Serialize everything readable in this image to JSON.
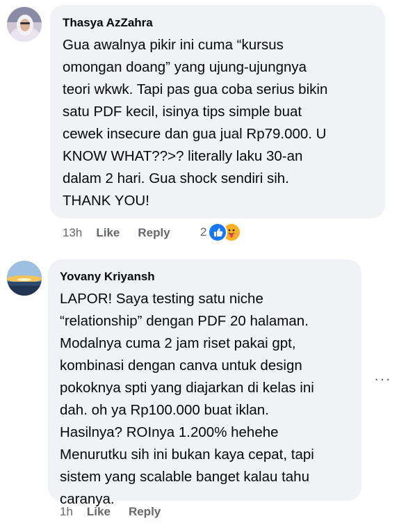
{
  "comments": [
    {
      "author": "Thasya AzZahra",
      "text": "Gua awalnya pikir ini cuma “kursus\nomongan doang” yang ujung-ujungnya\nteori wkwk. Tapi pas gua coba serius bikin\nsatu PDF kecil, isinya tips simple buat\ncewek insecure dan gua jual Rp79.000. U\nKNOW WHAT??>? literally laku 30-an\ndalam 2 hari. Gua shock sendiri sih.\nTHANK YOU!",
      "time": "13h",
      "like_label": "Like",
      "reply_label": "Reply",
      "reaction_count": "2",
      "reaction_icons": [
        "like-icon",
        "care-icon"
      ]
    },
    {
      "author": "Yovany Kriyansh",
      "text": "LAPOR! Saya testing satu niche\n“relationship” dengan PDF 20 halaman.\nModalnya cuma 2 jam riset pakai gpt,\nkombinasi dengan canva untuk design\npokoknya spti yang diajarkan di kelas ini\ndah. oh ya Rp100.000 buat iklan.\nHasilnya? ROInya 1.200% hehehe\nMenurutku sih ini bukan kaya cepat, tapi\nsistem yang scalable banget kalau tahu\ncaranya.",
      "time": "1h",
      "like_label": "Like",
      "reply_label": "Reply",
      "more_label": "···"
    }
  ],
  "colors": {
    "bubble": "#f0f2f5",
    "meta_text": "#65676b",
    "like_blue": "#1877f2",
    "care_yellow": "#f7b125"
  }
}
